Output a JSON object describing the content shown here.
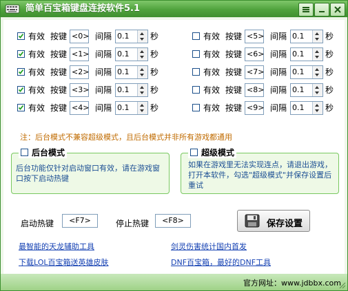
{
  "window": {
    "title": "简单百宝箱键盘连按软件5.1",
    "accent": "#4fa23c"
  },
  "rows": [
    {
      "checked": true,
      "effective": "有效",
      "key_label": "按键",
      "key": "<0>",
      "interval_label": "间隔",
      "interval": "0.1",
      "unit": "秒"
    },
    {
      "checked": true,
      "effective": "有效",
      "key_label": "按键",
      "key": "<1>",
      "interval_label": "间隔",
      "interval": "0.1",
      "unit": "秒"
    },
    {
      "checked": true,
      "effective": "有效",
      "key_label": "按键",
      "key": "<2>",
      "interval_label": "间隔",
      "interval": "0.1",
      "unit": "秒"
    },
    {
      "checked": true,
      "effective": "有效",
      "key_label": "按键",
      "key": "<3>",
      "interval_label": "间隔",
      "interval": "0.1",
      "unit": "秒"
    },
    {
      "checked": true,
      "effective": "有效",
      "key_label": "按键",
      "key": "<4>",
      "interval_label": "间隔",
      "interval": "0.1",
      "unit": "秒"
    },
    {
      "checked": false,
      "effective": "有效",
      "key_label": "按键",
      "key": "<5>",
      "interval_label": "间隔",
      "interval": "0.1",
      "unit": "秒"
    },
    {
      "checked": false,
      "effective": "有效",
      "key_label": "按键",
      "key": "<6>",
      "interval_label": "间隔",
      "interval": "0.1",
      "unit": "秒"
    },
    {
      "checked": false,
      "effective": "有效",
      "key_label": "按键",
      "key": "<7>",
      "interval_label": "间隔",
      "interval": "0.1",
      "unit": "秒"
    },
    {
      "checked": false,
      "effective": "有效",
      "key_label": "按键",
      "key": "<8>",
      "interval_label": "间隔",
      "interval": "0.1",
      "unit": "秒"
    },
    {
      "checked": false,
      "effective": "有效",
      "key_label": "按键",
      "key": "<9>",
      "interval_label": "间隔",
      "interval": "0.1",
      "unit": "秒"
    }
  ],
  "note": "注：后台模式不兼容超级模式，且后台模式并非所有游戏都通用",
  "background_mode": {
    "title": "后台模式",
    "checked": false,
    "desc": "后台功能仅针对启动窗口有效，请在游戏窗口按下启动热键"
  },
  "super_mode": {
    "title": "超级模式",
    "checked": false,
    "desc": "如果在游戏里无法实现连点，请退出游戏，打开本软件，勾选\"超级模式\"并保存设置后重试"
  },
  "hotkeys": {
    "start_label": "启动热键",
    "start_value": "<F7>",
    "stop_label": "停止热键",
    "stop_value": "<F8>"
  },
  "save_button": {
    "label": "保存设置"
  },
  "links": [
    "最智能的天龙辅助工具",
    "剑灵伤害统计国内首发",
    "下载LOL百宝箱送英雄皮肤",
    "DNF百宝箱，最好的DNF工具"
  ],
  "status": {
    "site": "官方网址：www.jdbbx.com"
  }
}
